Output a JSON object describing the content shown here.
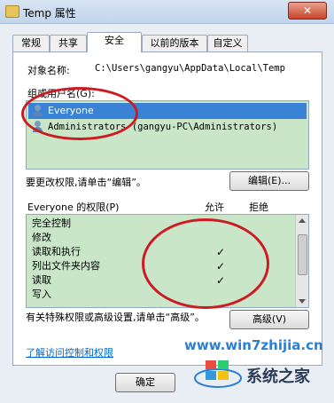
{
  "window": {
    "title": "Temp 属性",
    "close": "✕"
  },
  "tabs": [
    "常规",
    "共享",
    "安全",
    "以前的版本",
    "自定义"
  ],
  "object": {
    "label": "对象名称:",
    "path": "C:\\Users\\gangyu\\AppData\\Local\\Temp"
  },
  "groups": {
    "label": "组或用户名(G):",
    "items": [
      "Everyone",
      "Administrators (gangyu-PC\\Administrators)"
    ]
  },
  "edit": {
    "hint": "要更改权限,请单击“编辑”。",
    "button": "编辑(E)..."
  },
  "permissions": {
    "label": "Everyone 的权限(P)",
    "allow": "允许",
    "deny": "拒绝",
    "rows": [
      "完全控制",
      "修改",
      "读取和执行",
      "列出文件夹内容",
      "读取",
      "写入"
    ],
    "allow_checked": [
      false,
      false,
      true,
      true,
      true,
      false
    ],
    "check_glyph": "✓"
  },
  "special": {
    "hint": "有关特殊权限或高级设置,请单击“高级”。",
    "button": "高级(V)"
  },
  "link": "了解访问控制和权限",
  "ok_button": "确定",
  "watermark": {
    "site": "www.win7zhijia.cn",
    "name": "系统之家"
  }
}
